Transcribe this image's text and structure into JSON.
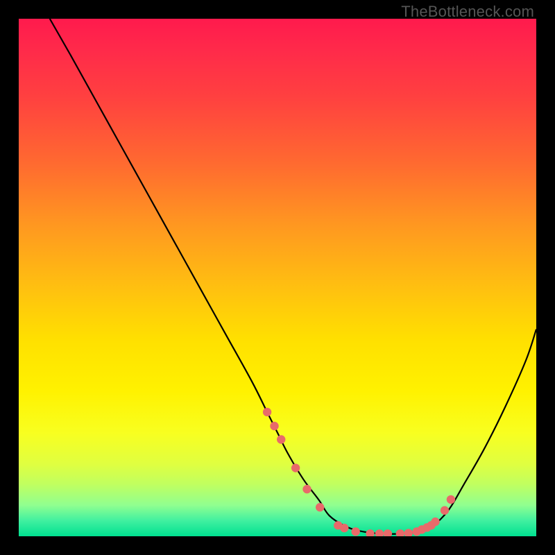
{
  "watermark": "TheBottleneck.com",
  "colors": {
    "background": "#000000",
    "curve": "#000000",
    "marker": "#e86a6a",
    "gradient_top": "#ff1a4d",
    "gradient_mid": "#ffe000",
    "gradient_bottom": "#00e090"
  },
  "chart_data": {
    "type": "line",
    "title": "",
    "xlabel": "",
    "ylabel": "",
    "xlim": [
      0,
      100
    ],
    "ylim": [
      0,
      100
    ],
    "series": [
      {
        "name": "curve",
        "x": [
          6,
          10,
          15,
          20,
          25,
          30,
          35,
          40,
          45,
          48,
          50,
          52,
          55,
          58,
          60,
          63,
          66,
          70,
          74,
          78,
          80,
          83,
          86,
          90,
          94,
          98,
          100
        ],
        "y": [
          100,
          93,
          84,
          75,
          66,
          57,
          48,
          39,
          30,
          24,
          20,
          16,
          11,
          7,
          4,
          2,
          1,
          0.5,
          0.5,
          1,
          2,
          5,
          10,
          17,
          25,
          34,
          40
        ]
      }
    ],
    "markers": {
      "name": "sample-points",
      "x": [
        48.0,
        49.4,
        50.7,
        53.5,
        55.7,
        58.2,
        61.7,
        62.9,
        65.1,
        67.9,
        69.7,
        71.3,
        73.7,
        75.3,
        76.9,
        77.9,
        78.9,
        79.7,
        80.5,
        82.3,
        83.5
      ],
      "y": [
        24.0,
        21.3,
        18.7,
        13.2,
        9.1,
        5.6,
        2.1,
        1.6,
        0.9,
        0.5,
        0.5,
        0.5,
        0.5,
        0.6,
        0.9,
        1.3,
        1.7,
        2.1,
        2.8,
        5.0,
        7.1
      ]
    }
  }
}
